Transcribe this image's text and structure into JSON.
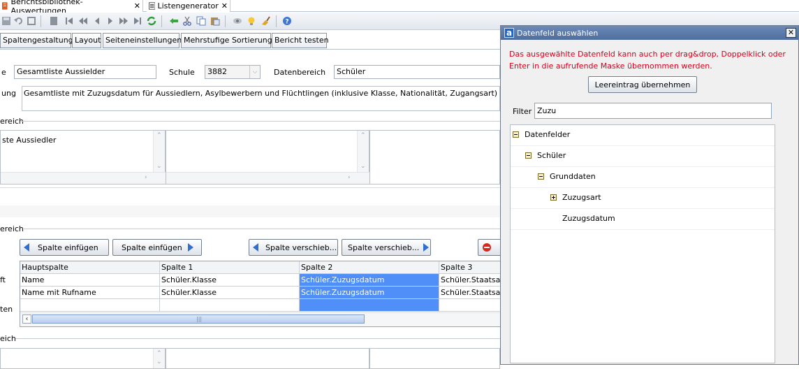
{
  "doc_tabs": [
    {
      "label": "Berichtsbibliothek-Auswertungen",
      "close": "✕"
    },
    {
      "label": "Listengenerator",
      "close": "✕"
    }
  ],
  "sub_tabs": [
    "Spaltengestaltung",
    "Layout",
    "Seiteneinstellungen",
    "Mehrstufige Sortierung",
    "Bericht testen"
  ],
  "form": {
    "name_label": "e",
    "name_value": "Gesamtliste Aussielder",
    "schule_label": "Schule",
    "schule_value": "3882",
    "datenbereich_label": "Datenbereich",
    "datenbereich_value": "Schüler",
    "beschreibung_label": "ung",
    "beschreibung_value": "Gesamtliste mit Zuzugsdatum für Aussiedlern, Asylbewerbern und Flüchtlingen (inklusive Klasse, Nationalität, Zugangsart)",
    "section1_label": "ereich",
    "text_area_value": "ste Aussiedler",
    "section2_label": "ereich",
    "section3_label": "eich",
    "row_label_1": "ft",
    "row_label_2": "ten"
  },
  "buttons": {
    "spalte_einfuegen_left": "Spalte einfügen",
    "spalte_einfuegen_right": "Spalte einfügen",
    "spalte_verschieben_left": "Spalte verschieb...",
    "spalte_verschieben_right": "Spalte verschieb..."
  },
  "grid": {
    "columns": [
      "Hauptspalte",
      "Spalte 1",
      "Spalte 2",
      "Spalte 3"
    ],
    "rows": [
      [
        "Name",
        "Schüler.Klasse",
        "Schüler.Zuzugsdatum",
        "Schüler.Staatsan"
      ],
      [
        "Name mit Rufname",
        "Schüler.Klasse",
        "Schüler.Zuzugsdatum",
        "Schüler.Staatsan"
      ],
      [
        "",
        "",
        "",
        ""
      ]
    ],
    "selected_column": 2
  },
  "dialog": {
    "title": "Datenfeld auswählen",
    "logo": "a",
    "message": "Das ausgewählte Datenfeld kann auch per drag&drop, Doppelklick oder Enter in die aufrufende Maske übernommen werden.",
    "empty_button": "Leereintrag übernehmen",
    "filter_label": "Filter",
    "filter_value": "Zuzu",
    "tree": [
      {
        "label": "Datenfelder",
        "level": 0,
        "state": "expanded"
      },
      {
        "label": "Schüler",
        "level": 1,
        "state": "expanded"
      },
      {
        "label": "Grunddaten",
        "level": 2,
        "state": "expanded"
      },
      {
        "label": "Zuzugsart",
        "level": 3,
        "state": "collapsed"
      },
      {
        "label": "Zuzugsdatum",
        "level": 3,
        "state": "leaf"
      }
    ]
  },
  "colors": {
    "accent": "#2f6fd0",
    "selection": "#4f8ff7",
    "dialog_title": "#5a78a8",
    "message_red": "#d6001c"
  },
  "icons": [
    "report-icon",
    "list-icon",
    "save-icon",
    "undo-icon",
    "redo-icon",
    "new-icon",
    "first-icon",
    "prev-fast-icon",
    "prev-icon",
    "next-icon",
    "next-fast-icon",
    "last-icon",
    "refresh-icon",
    "back-arrow-icon",
    "cut-icon",
    "copy-icon",
    "paste-icon",
    "eye-icon",
    "bulb-icon",
    "broom-icon",
    "help-icon"
  ]
}
